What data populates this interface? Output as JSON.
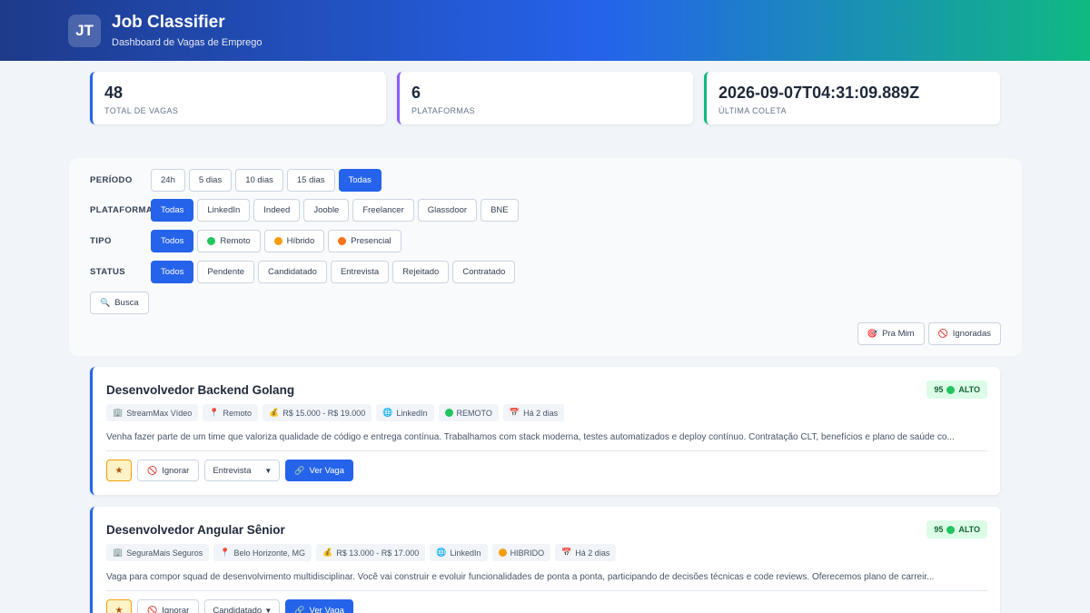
{
  "header": {
    "logo_text": "JT",
    "title": "Job Classifier",
    "subtitle": "Dashboard de Vagas de Emprego",
    "gradient_colors": [
      "#1e3a8a",
      "#2563eb",
      "#10b981"
    ]
  },
  "stats": [
    {
      "value": "48",
      "label": "TOTAL DE VAGAS",
      "accent": "#2563eb"
    },
    {
      "value": "6",
      "label": "PLATAFORMAS",
      "accent": "#8b5cf6"
    },
    {
      "value": "2026-09-07T04:31:09.889Z",
      "label": "ÚLTIMA COLETA",
      "accent": "#10b981"
    }
  ],
  "filters": {
    "periodo": {
      "label": "PERÍODO",
      "options": [
        "24h",
        "5 dias",
        "10 dias",
        "15 dias",
        "Todas"
      ],
      "selected": "Todas"
    },
    "plataforma": {
      "label": "PLATAFORMA",
      "options": [
        "Todas",
        "LinkedIn",
        "Indeed",
        "Jooble",
        "Freelancer",
        "Glassdoor",
        "BNE"
      ],
      "selected": "Todas"
    },
    "tipo": {
      "label": "TIPO",
      "options": [
        "Todos",
        "Remoto",
        "Híbrido",
        "Presencial"
      ],
      "selected": "Todos"
    },
    "status": {
      "label": "STATUS",
      "options": [
        "Todos",
        "Pendente",
        "Candidatado",
        "Entrevista",
        "Rejeitado",
        "Contratado"
      ],
      "selected": "Todos"
    },
    "busca_label": "Busca",
    "pra_mim_label": "Pra Mim",
    "ignoradas_label": "Ignoradas"
  },
  "jobs": [
    {
      "title": "Desenvolvedor Backend Golang",
      "score": "95",
      "level": "ALTO",
      "company": "StreamMax Vídeo",
      "location": "Remoto",
      "salary": "R$ 15.000 - R$ 19.000",
      "platform": "LinkedIn",
      "work_type": "REMOTO",
      "posted": "Há 2 dias",
      "description": "Venha fazer parte de um time que valoriza qualidade de código e entrega contínua. Trabalhamos com stack moderna, testes automatizados e deploy contínuo. Contratação CLT, benefícios e plano de saúde co...",
      "ignore_label": "Ignorar",
      "status": "Entrevista",
      "view_label": "Ver Vaga"
    },
    {
      "title": "Desenvolvedor Angular Sênior",
      "score": "95",
      "level": "ALTO",
      "company": "SeguraMais Seguros",
      "location": "Belo Horizonte, MG",
      "salary": "R$ 13.000 - R$ 17.000",
      "platform": "LinkedIn",
      "work_type": "HIBRIDO",
      "posted": "Há 2 dias",
      "description": "Vaga para compor squad de desenvolvimento multidisciplinar. Você vai construir e evoluir funcionalidades de ponta a ponta, participando de decisões técnicas e code reviews. Oferecemos plano de carreir...",
      "ignore_label": "Ignorar",
      "status": "Candidatado",
      "view_label": "Ver Vaga"
    }
  ]
}
